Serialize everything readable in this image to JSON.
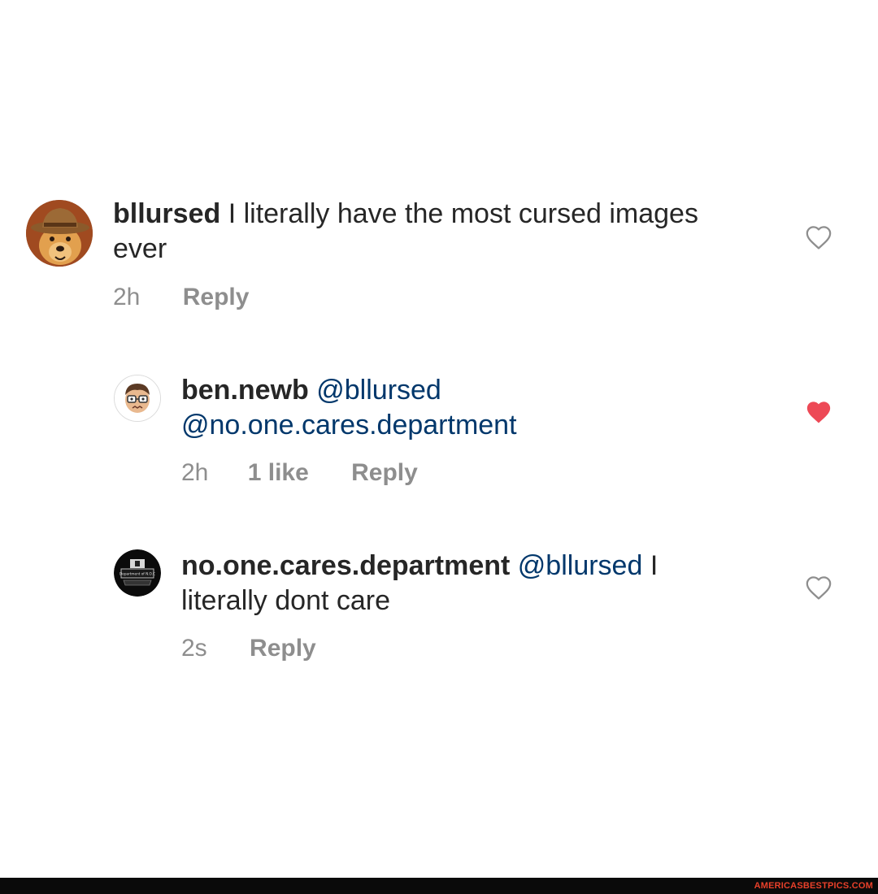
{
  "comments": [
    {
      "username": "bllursed",
      "mentions": [],
      "text": " I literally have the most cursed images ever",
      "time": "2h",
      "likes_label": "",
      "reply_label": "Reply",
      "liked": false,
      "avatar_icon": "dog-in-hat-avatar"
    },
    {
      "username": "ben.newb",
      "mention1": "@bllursed",
      "mention2": "@no.one.cares.department",
      "text": "",
      "time": "2h",
      "likes_label": "1 like",
      "reply_label": "Reply",
      "liked": true,
      "avatar_icon": "cartoon-face-avatar"
    },
    {
      "username": "no.one.cares.department",
      "mention1": "@bllursed",
      "text_inline": " I",
      "text_line2": "literally dont care",
      "time": "2s",
      "likes_label": "",
      "reply_label": "Reply",
      "liked": false,
      "avatar_icon": "department-logo-avatar",
      "avatar_text": "Department of N.O.C"
    }
  ],
  "colors": {
    "heart_liked": "#ed4956",
    "mention": "#00376b",
    "meta": "#8e8e8e",
    "watermark": "#e8402a"
  },
  "watermark": "AMERICASBESTPICS.COM"
}
